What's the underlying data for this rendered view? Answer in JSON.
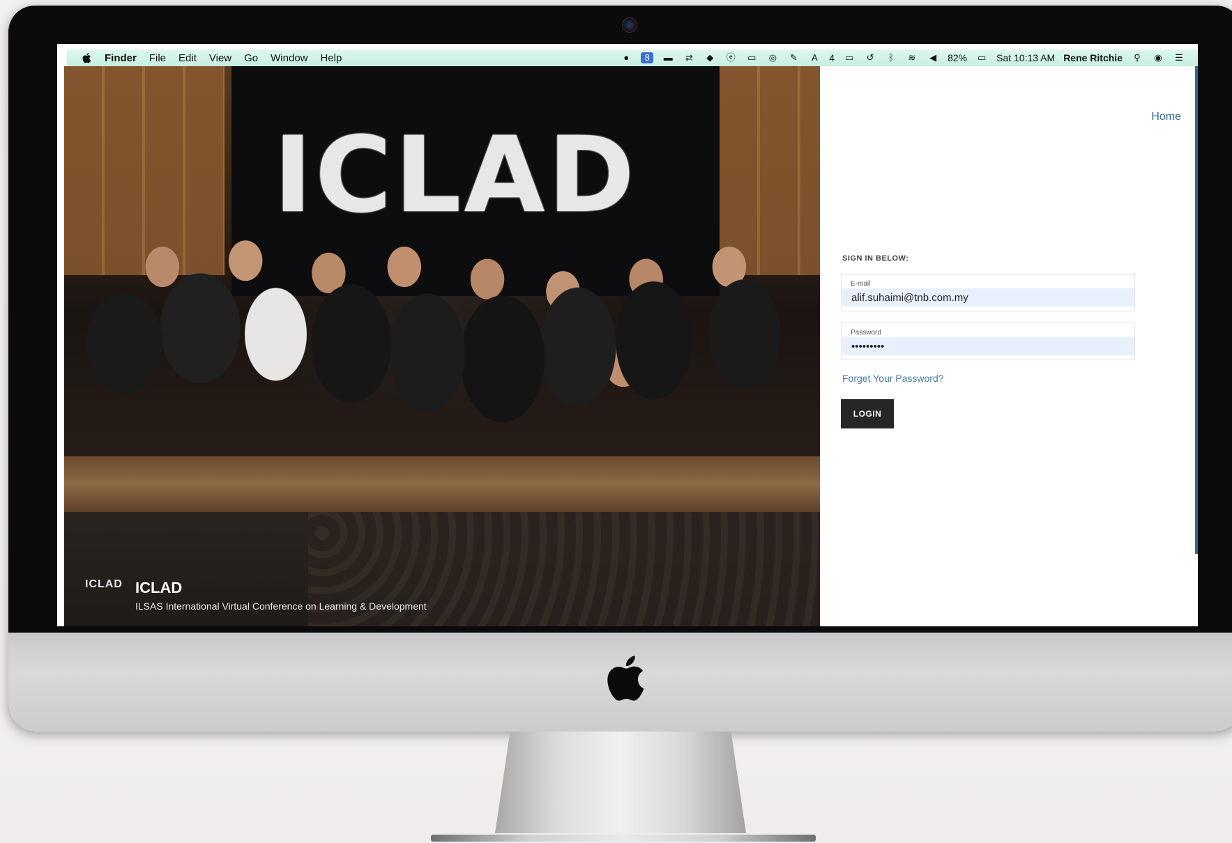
{
  "menubar": {
    "items": [
      "Finder",
      "File",
      "Edit",
      "View",
      "Go",
      "Window",
      "Help"
    ],
    "status_icons": [
      "notification-icon",
      "app-icon",
      "message-icon",
      "sync-icon",
      "dropbox-icon",
      "e-icon",
      "screen-icon",
      "cloud-icon",
      "tool-icon",
      "font-icon",
      "display-icon",
      "time-machine-icon",
      "bluetooth-icon",
      "wifi-icon",
      "volume-icon"
    ],
    "adobe_count": "4",
    "battery": "82%",
    "clock": "Sat 10:13 AM",
    "user": "Rene Ritchie"
  },
  "hero": {
    "backdrop_logo": "ICLAD",
    "brand_logo": "ICLAD",
    "title": "ICLAD",
    "subtitle": "ILSAS International Virtual Conference on Learning & Development"
  },
  "login": {
    "home_link": "Home",
    "heading": "SIGN IN BELOW:",
    "email_label": "E-mail",
    "email_value": "alif.suhaimi@tnb.com.my",
    "password_label": "Password",
    "password_value": "•••••••••",
    "forgot_link": "Forget Your Password?",
    "login_button": "LOGIN"
  },
  "colors": {
    "accent_link": "#3b6a8c",
    "button": "#262626",
    "autofill": "#e8f0fe",
    "menubar": "#c6efdf"
  }
}
